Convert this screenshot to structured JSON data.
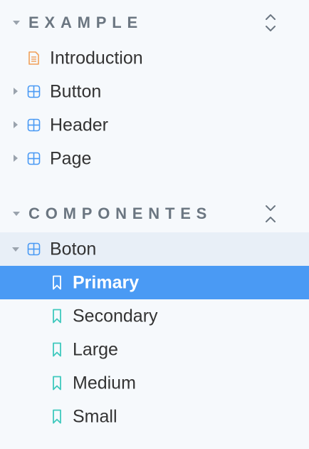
{
  "sections": [
    {
      "title": "EXAMPLE",
      "items": [
        {
          "label": "Introduction",
          "icon": "document-icon"
        },
        {
          "label": "Button",
          "icon": "component-icon"
        },
        {
          "label": "Header",
          "icon": "component-icon"
        },
        {
          "label": "Page",
          "icon": "component-icon"
        }
      ]
    },
    {
      "title": "COMPONENTES",
      "group": {
        "label": "Boton",
        "icon": "component-icon"
      },
      "stories": [
        {
          "label": "Primary",
          "icon": "bookmark-icon",
          "selected": true
        },
        {
          "label": "Secondary",
          "icon": "bookmark-icon"
        },
        {
          "label": "Large",
          "icon": "bookmark-icon"
        },
        {
          "label": "Medium",
          "icon": "bookmark-icon"
        },
        {
          "label": "Small",
          "icon": "bookmark-icon"
        }
      ]
    }
  ],
  "colors": {
    "background": "#f6f9fc",
    "selected_bg": "#4a9af4",
    "group_open_bg": "#e8eff7",
    "document_icon": "#f0a05a",
    "component_icon": "#4a9af4",
    "story_icon": "#3fc9bd",
    "section_title": "#6b7681"
  }
}
